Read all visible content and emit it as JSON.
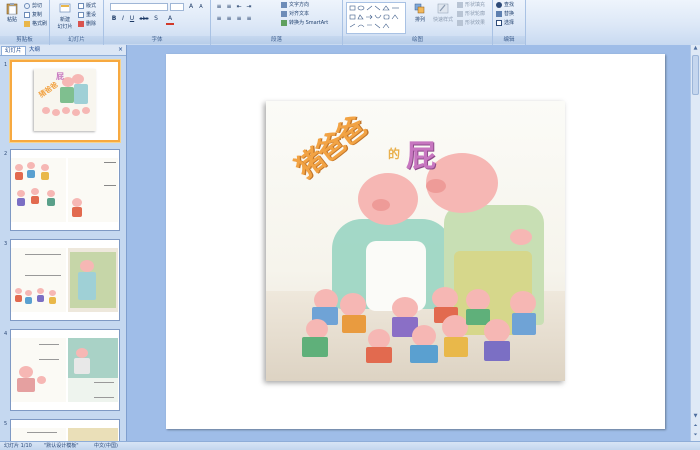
{
  "ribbon": {
    "clipboard": {
      "paste": "粘贴",
      "cut": "剪切",
      "copy": "复制",
      "format_painter": "格式刷",
      "label": "剪贴板"
    },
    "slides": {
      "new_slide": "新建",
      "new_slide_line2": "幻灯片",
      "layout": "版式",
      "reset": "重设",
      "delete": "删除",
      "label": "幻灯片"
    },
    "font": {
      "bold": "B",
      "italic": "I",
      "underline": "U",
      "strike": "abc",
      "shadow": "S",
      "label": "字体"
    },
    "paragraph": {
      "text_direction": "文字方向",
      "align_text": "对齐文本",
      "smartart": "转换为 SmartArt",
      "label": "段落"
    },
    "drawing": {
      "arrange": "排列",
      "quick_styles": "快速样式",
      "shape_fill": "形状填充",
      "shape_outline": "形状轮廓",
      "shape_effects": "形状效果",
      "label": "绘图"
    },
    "editing": {
      "find": "查找",
      "replace": "替换",
      "select": "选择",
      "label": "编辑"
    }
  },
  "panel": {
    "tab_slides": "幻灯片",
    "tab_outline": "大纲",
    "close": "×",
    "slides": [
      {
        "num": "1"
      },
      {
        "num": "2"
      },
      {
        "num": "3"
      },
      {
        "num": "4"
      },
      {
        "num": "5"
      }
    ]
  },
  "slide": {
    "title_main": "猪爸爸",
    "title_mid": "的",
    "title_big": "屁"
  },
  "status": {
    "slide_counter": "幻灯片 1/10",
    "theme": "\"默认设计模板\"",
    "language": "中文(中国)"
  },
  "colors": {
    "accent": "#15428b",
    "selected_thumb": "#f7a940",
    "title_orange": "#f2a344",
    "title_purple": "#c776c0"
  }
}
